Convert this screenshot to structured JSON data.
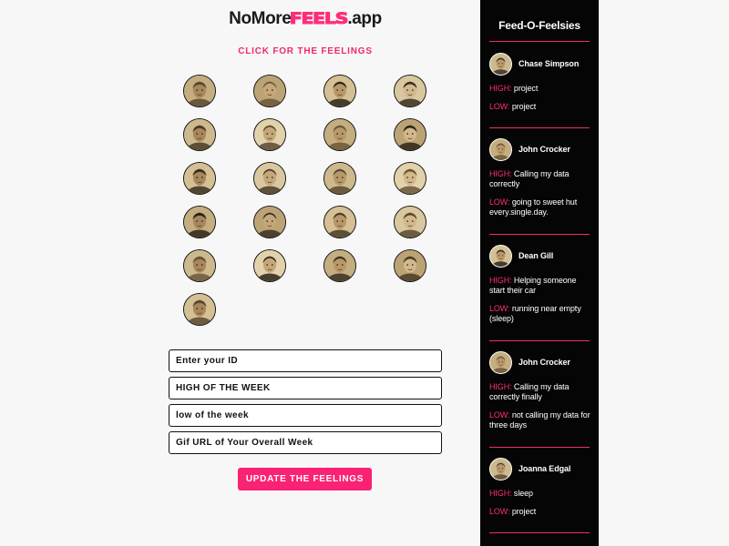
{
  "logo": {
    "prefix": "NoMore",
    "highlight": "FEELS",
    "suffix": ".app"
  },
  "subtitle": "CLICK FOR THE FEELINGS",
  "avatars": [
    "avatar-1",
    "avatar-2",
    "avatar-3",
    "avatar-4",
    "avatar-5",
    "avatar-6",
    "avatar-7",
    "avatar-8",
    "avatar-9",
    "avatar-10",
    "avatar-11",
    "avatar-12",
    "avatar-13",
    "avatar-14",
    "avatar-15",
    "avatar-16",
    "avatar-17",
    "avatar-18",
    "avatar-19",
    "avatar-20",
    "avatar-21"
  ],
  "form": {
    "id_placeholder": "Enter your ID",
    "high_placeholder": "HIGH OF THE WEEK",
    "low_placeholder": "low of the week",
    "gif_placeholder": "Gif URL of Your Overall Week",
    "button_label": "UPDATE THE FEELINGS"
  },
  "sidebar": {
    "title": "Feed-O-Feelsies",
    "high_key": "HIGH:",
    "low_key": "LOW:",
    "items": [
      {
        "name": "Chase Simpson",
        "high": "project",
        "low": "project"
      },
      {
        "name": "John Crocker",
        "high": "Calling my data correctly",
        "low": "going to sweet hut every.single.day."
      },
      {
        "name": "Dean Gill",
        "high": "Helping someone start their car",
        "low": "running near empty (sleep)"
      },
      {
        "name": "John Crocker",
        "high": "Calling my data correctly finally",
        "low": "not calling my data for three days"
      },
      {
        "name": "Joanna Edgal",
        "high": "sleep",
        "low": "project"
      }
    ]
  },
  "colors": {
    "accent": "#fa2272",
    "sidebar_bg": "#050505",
    "page_bg": "#f7f7f7"
  }
}
